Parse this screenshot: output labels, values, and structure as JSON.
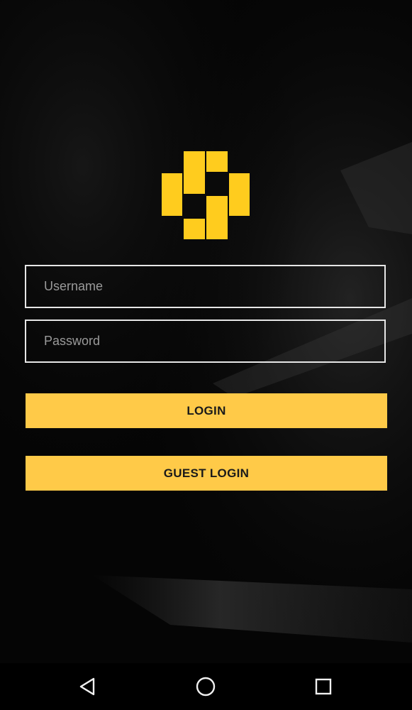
{
  "colors": {
    "accent": "#ffca48",
    "background": "#050505",
    "field_border": "#e6e6e6",
    "placeholder": "#9a9a9a"
  },
  "logo": {
    "icon": "yellow-block-logo-icon"
  },
  "login_form": {
    "username_placeholder": "Username",
    "username_value": "",
    "password_placeholder": "Password",
    "password_value": "",
    "login_label": "LOGIN",
    "guest_login_label": "GUEST LOGIN"
  },
  "navbar": {
    "back_icon": "back-triangle-icon",
    "home_icon": "home-circle-icon",
    "recent_icon": "recent-apps-square-icon"
  }
}
